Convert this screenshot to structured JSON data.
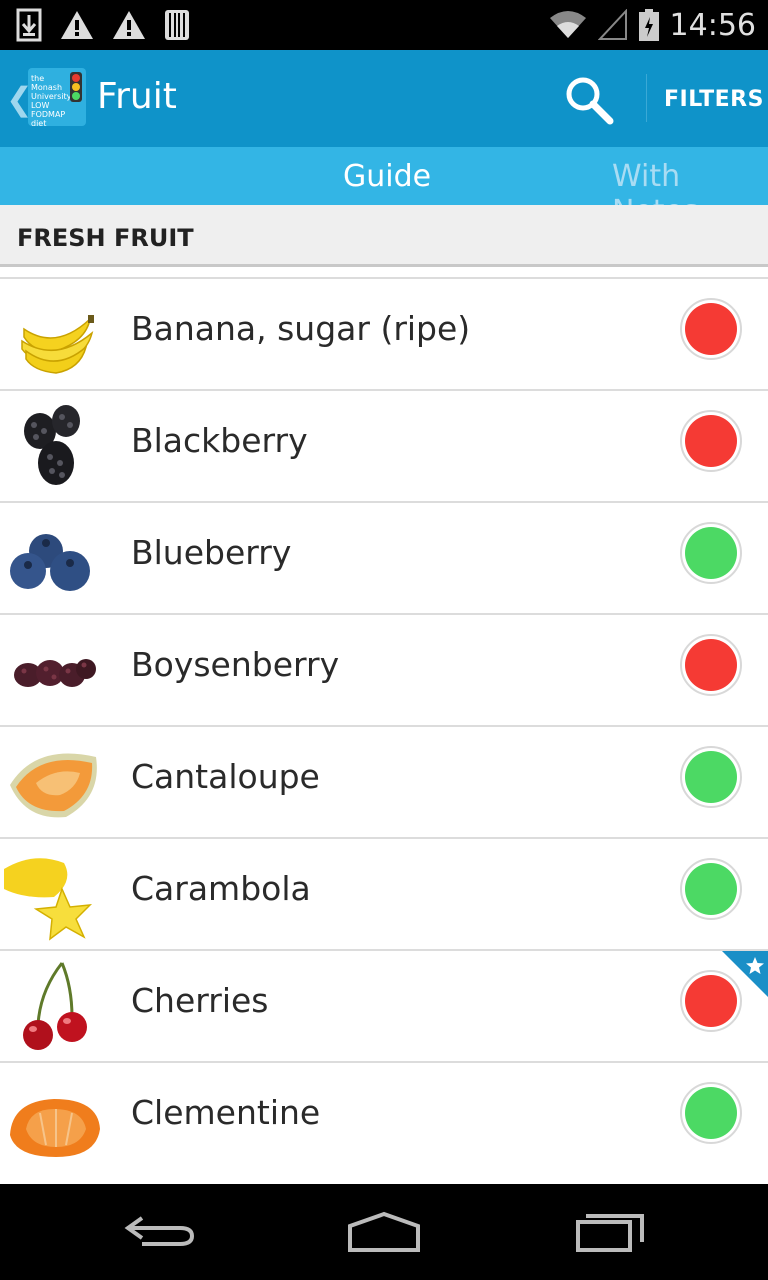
{
  "status_bar": {
    "time": "14:56",
    "icons": [
      "download-icon",
      "warning-icon",
      "warning-icon",
      "barcode-icon",
      "wifi-icon",
      "signal-icon",
      "battery-icon"
    ]
  },
  "action_bar": {
    "title": "Fruit",
    "filters_label": "FILTERS",
    "logo_text": [
      "the",
      "Monash",
      "University",
      "LOW",
      "FODMAP",
      "diet"
    ]
  },
  "tabs": [
    {
      "label": "Guide",
      "selected": true
    },
    {
      "label": "With Notes",
      "selected": false
    }
  ],
  "section": {
    "title": "FRESH FRUIT"
  },
  "colors": {
    "action_bar": "#0f93c9",
    "tab_bar": "#33b5e5",
    "status_red": "#f53a34",
    "status_green": "#4cd964",
    "notes_corner": "#1a8fc7"
  },
  "items": [
    {
      "name": "Banana, sugar (ripe)",
      "status": "red",
      "icon": "banana-icon",
      "has_notes": false
    },
    {
      "name": "Blackberry",
      "status": "red",
      "icon": "blackberry-icon",
      "has_notes": false
    },
    {
      "name": "Blueberry",
      "status": "green",
      "icon": "blueberry-icon",
      "has_notes": false
    },
    {
      "name": "Boysenberry",
      "status": "red",
      "icon": "boysenberry-icon",
      "has_notes": false
    },
    {
      "name": "Cantaloupe",
      "status": "green",
      "icon": "cantaloupe-icon",
      "has_notes": false
    },
    {
      "name": "Carambola",
      "status": "green",
      "icon": "carambola-icon",
      "has_notes": false
    },
    {
      "name": "Cherries",
      "status": "red",
      "icon": "cherries-icon",
      "has_notes": true
    },
    {
      "name": "Clementine",
      "status": "green",
      "icon": "clementine-icon",
      "has_notes": false
    }
  ],
  "nav_bar": {
    "buttons": [
      "back-icon",
      "home-icon",
      "recents-icon"
    ]
  }
}
